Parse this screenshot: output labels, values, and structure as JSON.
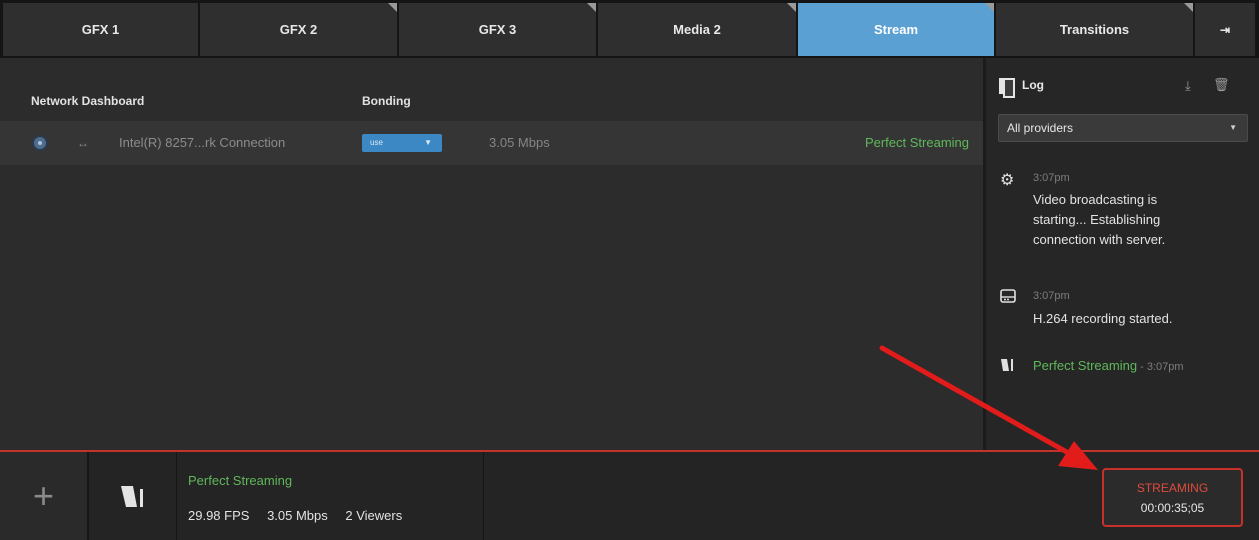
{
  "tabs": [
    {
      "label": "GFX 1"
    },
    {
      "label": "GFX 2"
    },
    {
      "label": "GFX 3"
    },
    {
      "label": "Media 2"
    },
    {
      "label": "Stream",
      "active": true
    },
    {
      "label": "Transitions"
    }
  ],
  "tab_end_icon": "skip-to-end-icon",
  "dashboard": {
    "network_heading": "Network Dashboard",
    "bonding_heading": "Bonding",
    "connection": {
      "arrows_icon": "↔",
      "name": "Intel(R) 8257...rk Connection",
      "bonding_value": "use",
      "speed": "3.05 Mbps",
      "status": "Perfect Streaming"
    }
  },
  "log": {
    "title": "Log",
    "provider_filter": "All providers",
    "entries": [
      {
        "icon": "gear-icon",
        "time": "3:07pm",
        "message": [
          "Video broadcasting is",
          "starting... Establishing",
          "connection with server."
        ]
      },
      {
        "icon": "recording-drive-icon",
        "time": "3:07pm",
        "message": [
          "H.264 recording started."
        ]
      },
      {
        "icon": "stream-logo-icon",
        "status": "Perfect Streaming",
        "time": " - 3:07pm"
      }
    ]
  },
  "bottom": {
    "stream_status": "Perfect Streaming",
    "fps": "29.98 FPS",
    "bitrate": "3.05 Mbps",
    "viewers": "2 Viewers",
    "stream_button_label": "STREAMING",
    "stream_duration": "00:00:35;05"
  },
  "colors": {
    "active_tab": "#5aa0d2",
    "status_green": "#5fb85a",
    "streaming_red": "#c8302a",
    "annotation_arrow": "#e21b1b"
  }
}
